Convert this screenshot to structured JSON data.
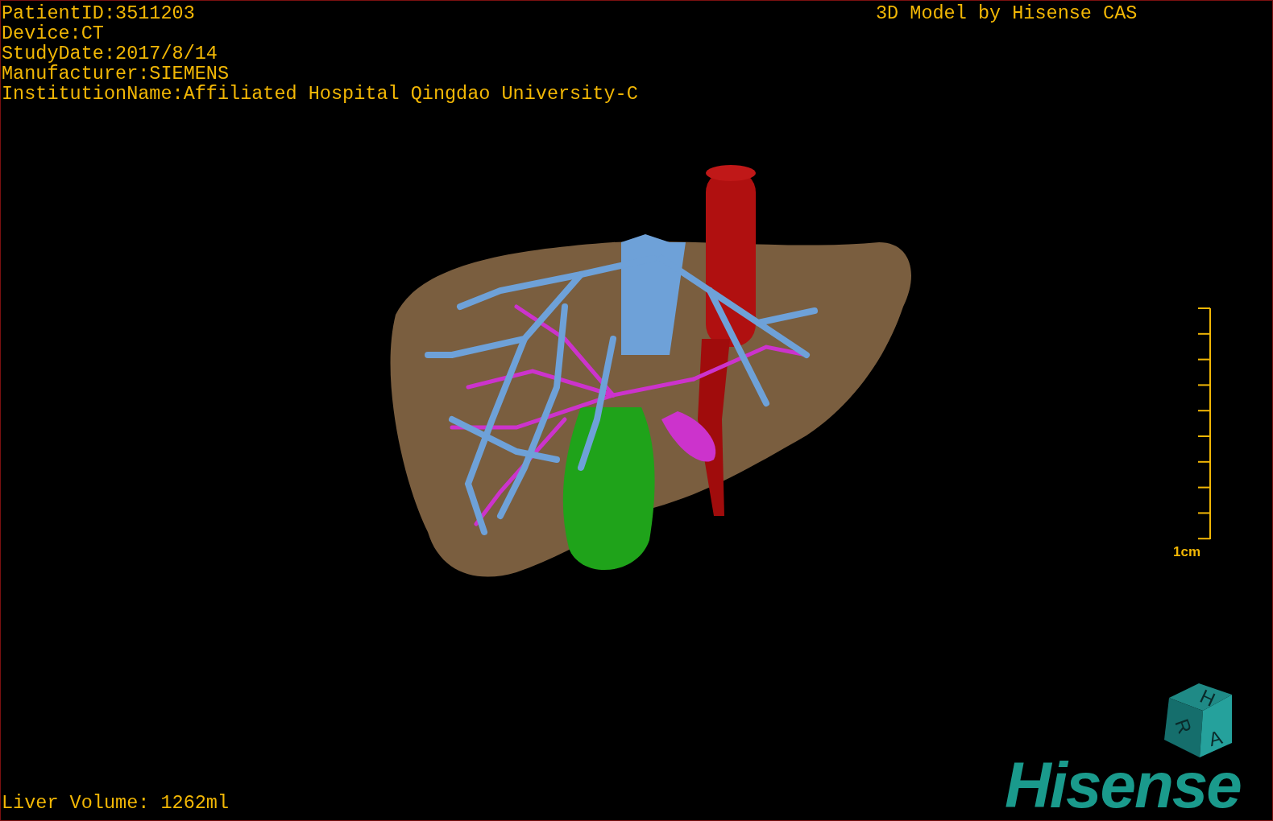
{
  "info_lines": [
    "PatientID:3511203",
    "Device:CT",
    "StudyDate:2017/8/14",
    "Manufacturer:SIEMENS",
    "InstitutionName:Affiliated Hospital Qingdao University-C"
  ],
  "title": "3D Model by Hisense CAS",
  "scale_bar": {
    "label": "1cm"
  },
  "orientation_cube": {
    "faces": [
      {
        "kind": "top",
        "letter": "H"
      },
      {
        "kind": "left",
        "letter": "R"
      },
      {
        "kind": "front",
        "letter": "A"
      }
    ]
  },
  "logo": "Hisense",
  "liver_volume": "Liver Volume: 1262ml"
}
